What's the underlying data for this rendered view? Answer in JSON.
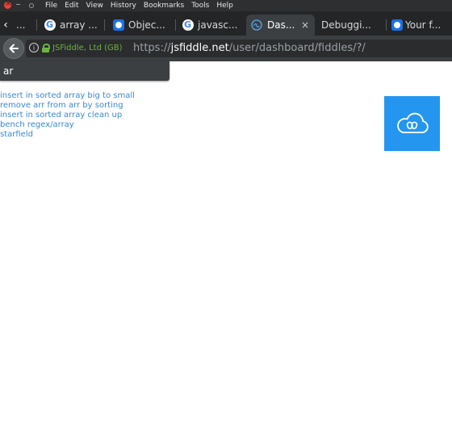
{
  "menu": [
    "File",
    "Edit",
    "View",
    "History",
    "Bookmarks",
    "Tools",
    "Help"
  ],
  "tabs": [
    {
      "label": "...",
      "icon": "none"
    },
    {
      "label": "array ...",
      "icon": "google-icon"
    },
    {
      "label": "Objec...",
      "icon": "stackoverflow-icon"
    },
    {
      "label": "javasc...",
      "icon": "google-icon"
    },
    {
      "label": "Das...",
      "icon": "jsfiddle-icon",
      "active": true,
      "close": "×"
    },
    {
      "label": "Debuggi...",
      "icon": "none"
    },
    {
      "label": "Your f...",
      "icon": "stackoverflow-icon"
    }
  ],
  "urlbar": {
    "site_identity": "JSFiddle, Ltd (GB)",
    "url_prefix": "https://",
    "url_host": "jsfiddle.net",
    "url_path": "/user/dashboard/fiddles/?/"
  },
  "search": {
    "value": "ar"
  },
  "fiddles": [
    "insert in sorted array big to small",
    "remove arr from arr by sorting",
    "insert in sorted array clean up",
    "bench regex/array",
    "starfield"
  ],
  "colors": {
    "link": "#3a87d6",
    "tile": "#2496f0",
    "secure": "#6cb33f"
  }
}
